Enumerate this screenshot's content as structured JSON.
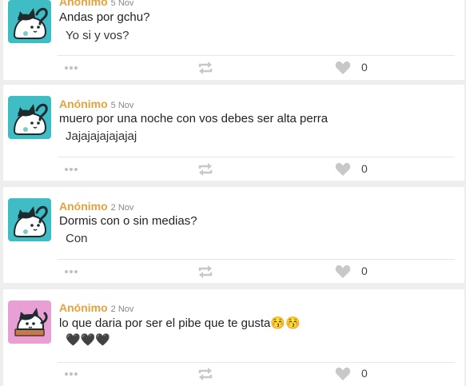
{
  "posts": [
    {
      "author": "Anónimo",
      "date": "5 Nov",
      "question": "Andas por gchu?",
      "answer": "Yo si y vos?",
      "likes": "0",
      "avatar_color": "#3fbcc4",
      "avatar_icon": "cat-icon"
    },
    {
      "author": "Anónimo",
      "date": "5 Nov",
      "question": "muero por una noche con vos debes ser alta perra",
      "answer": "Jajajajajajajaj",
      "likes": "0",
      "avatar_color": "#3fbcc4",
      "avatar_icon": "cat-icon"
    },
    {
      "author": "Anónimo",
      "date": "2 Nov",
      "question": "Dormis con o sin medias?",
      "answer": "Con",
      "likes": "0",
      "avatar_color": "#3fbcc4",
      "avatar_icon": "cat-icon"
    },
    {
      "author": "Anónimo",
      "date": "2 Nov",
      "question": "lo que daria por ser el pibe que te gusta😚😚",
      "answer": "🖤🖤🖤",
      "likes": "0",
      "avatar_color": "#e89fd4",
      "avatar_icon": "cat-on-box-icon"
    }
  ],
  "icons": {
    "more": "more-dots-icon",
    "repost": "repost-icon",
    "like": "heart-icon"
  },
  "colors": {
    "author": "#e5a23c",
    "background": "#eeeeee",
    "card": "#ffffff",
    "icon": "#c8c8c8"
  }
}
